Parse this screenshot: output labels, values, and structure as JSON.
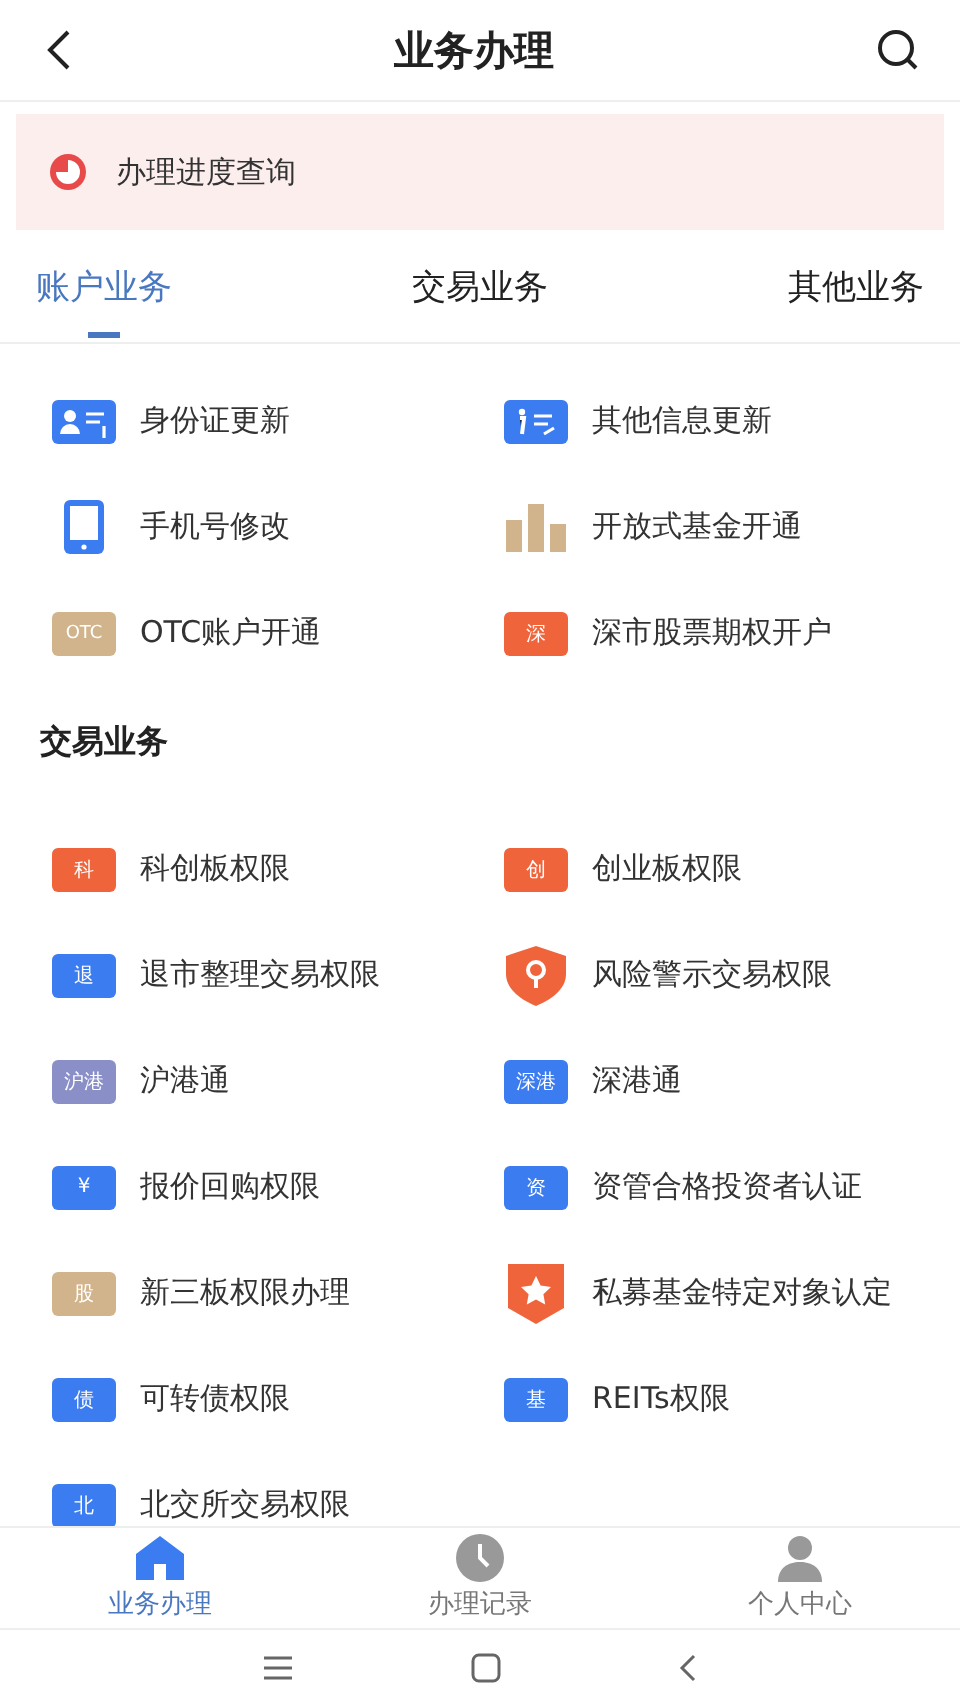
{
  "header": {
    "title": "业务办理"
  },
  "progress_banner": {
    "label": "办理进度查询"
  },
  "tabs": [
    {
      "label": "账户业务",
      "selected": true
    },
    {
      "label": "交易业务",
      "selected": false
    },
    {
      "label": "其他业务",
      "selected": false
    }
  ],
  "account_items": [
    {
      "label": "身份证更新",
      "kind": "idcard",
      "color": "#3b7cf0"
    },
    {
      "label": "其他信息更新",
      "kind": "info",
      "color": "#3b7cf0"
    },
    {
      "label": "手机号修改",
      "kind": "phone",
      "color": "#3b7cf0"
    },
    {
      "label": "开放式基金开通",
      "kind": "bars",
      "color": "#d2b48c"
    },
    {
      "label": "OTC账户开通",
      "kind": "badge",
      "badge": "OTC",
      "color": "#d2b48c"
    },
    {
      "label": "深市股票期权开户",
      "kind": "badge",
      "badge": "深",
      "color": "#f0643c"
    }
  ],
  "trade_section": {
    "title": "交易业务"
  },
  "trade_items": [
    {
      "label": "科创板权限",
      "kind": "badge",
      "badge": "科",
      "color": "#f0643c"
    },
    {
      "label": "创业板权限",
      "kind": "badge",
      "badge": "创",
      "color": "#f0643c"
    },
    {
      "label": "退市整理交易权限",
      "kind": "badge",
      "badge": "退",
      "color": "#3b7cf0"
    },
    {
      "label": "风险警示交易权限",
      "kind": "shield",
      "color": "#f0643c"
    },
    {
      "label": "沪港通",
      "kind": "badge",
      "badge": "沪港",
      "color": "#8a8fc8"
    },
    {
      "label": "深港通",
      "kind": "badge",
      "badge": "深港",
      "color": "#3b7cf0"
    },
    {
      "label": "报价回购权限",
      "kind": "badge",
      "badge": "¥",
      "color": "#3b7cf0"
    },
    {
      "label": "资管合格投资者认证",
      "kind": "badge",
      "badge": "资",
      "color": "#3b7cf0"
    },
    {
      "label": "新三板权限办理",
      "kind": "badge",
      "badge": "股",
      "color": "#d2b48c"
    },
    {
      "label": "私募基金特定对象认定",
      "kind": "star",
      "color": "#f0643c"
    },
    {
      "label": "可转债权限",
      "kind": "badge",
      "badge": "债",
      "color": "#3b7cf0"
    },
    {
      "label": "REITs权限",
      "kind": "badge",
      "badge": "基",
      "color": "#3b7cf0"
    },
    {
      "label": "北交所交易权限",
      "kind": "badge",
      "badge": "北",
      "color": "#3b7cf0"
    }
  ],
  "bottom_nav": [
    {
      "label": "业务办理",
      "kind": "home",
      "selected": true
    },
    {
      "label": "办理记录",
      "kind": "clock",
      "selected": false
    },
    {
      "label": "个人中心",
      "kind": "person",
      "selected": false
    }
  ]
}
